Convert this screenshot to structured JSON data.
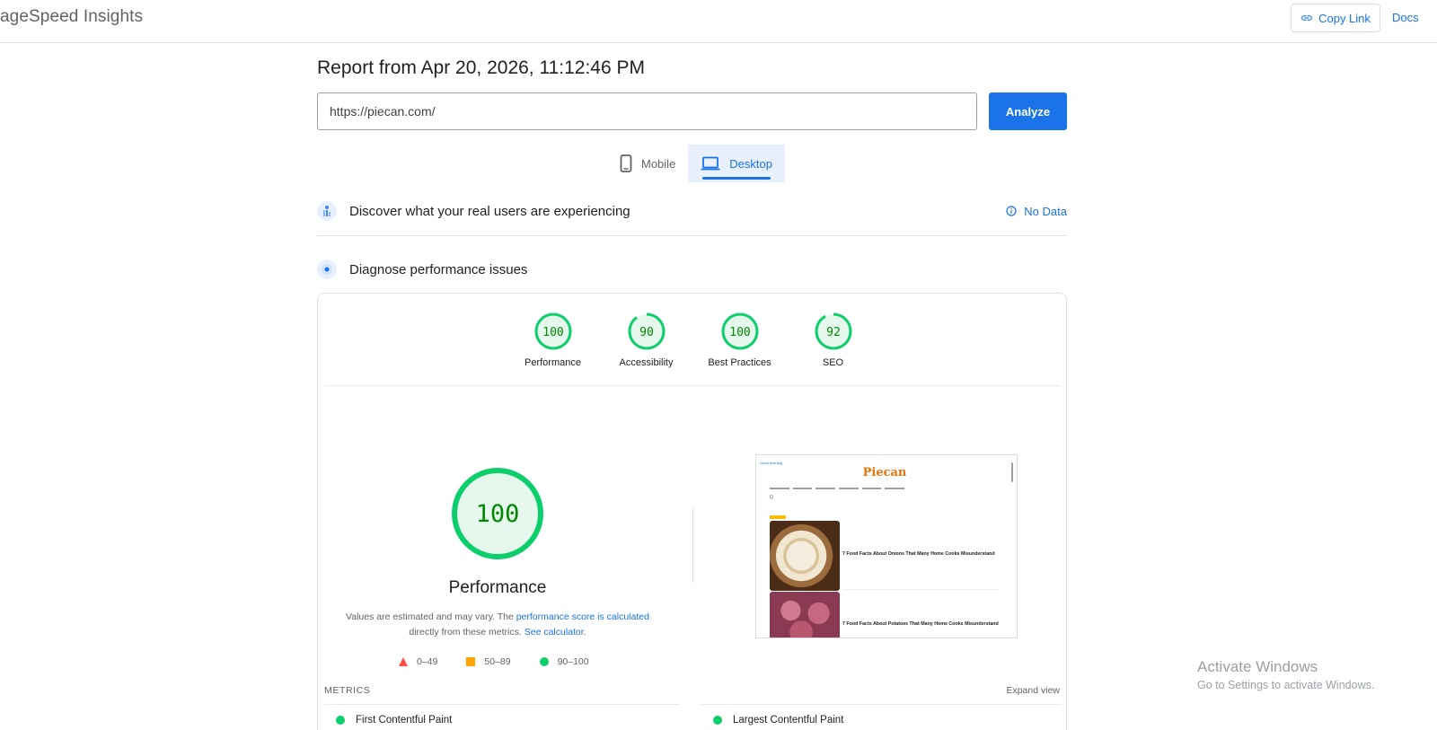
{
  "header": {
    "brand": "ageSpeed Insights",
    "copy_link_label": "Copy Link",
    "docs_label": "Docs"
  },
  "report": {
    "title": "Report from Apr 20, 2026, 11:12:46 PM",
    "url_value": "https://piecan.com/",
    "analyze_label": "Analyze"
  },
  "tabs": [
    {
      "label": "Mobile",
      "active": false
    },
    {
      "label": "Desktop",
      "active": true
    }
  ],
  "field_data": {
    "title": "Discover what your real users are experiencing",
    "status": "No Data"
  },
  "diagnose": {
    "title": "Diagnose performance issues"
  },
  "scores": [
    {
      "label": "Performance",
      "value": 100
    },
    {
      "label": "Accessibility",
      "value": 90
    },
    {
      "label": "Best Practices",
      "value": 100
    },
    {
      "label": "SEO",
      "value": 92
    }
  ],
  "performance": {
    "score": 100,
    "label": "Performance",
    "note_prefix": "Values are estimated and may vary. The ",
    "note_link1": "performance score is calculated",
    "note_mid": " directly from these metrics. ",
    "note_link2": "See calculator",
    "note_suffix": "."
  },
  "legend": [
    {
      "range": "0–49",
      "shape": "triangle",
      "color": "#ff4e42"
    },
    {
      "range": "50–89",
      "shape": "square",
      "color": "#ffa400"
    },
    {
      "range": "90–100",
      "shape": "circle",
      "color": "#0cce6b"
    }
  ],
  "screenshot": {
    "small_text": "Good evening",
    "logo": "Piecan",
    "search": "Q",
    "captions": [
      "7 Food Facts About Onions That Many Home Cooks Misunderstand",
      "7 Food Facts About Potatoes That Many Home Cooks Misunderstand"
    ]
  },
  "metrics": {
    "heading": "METRICS",
    "expand_label": "Expand view",
    "items": [
      {
        "name": "First Contentful Paint",
        "status": "good"
      },
      {
        "name": "Largest Contentful Paint",
        "status": "good"
      }
    ]
  },
  "colors": {
    "good": "#0cce6b",
    "good_fill": "#e6f8ee",
    "good_text": "#008800",
    "accent": "#1a73e8"
  },
  "watermark": {
    "line1": "Activate Windows",
    "line2": "Go to Settings to activate Windows."
  }
}
